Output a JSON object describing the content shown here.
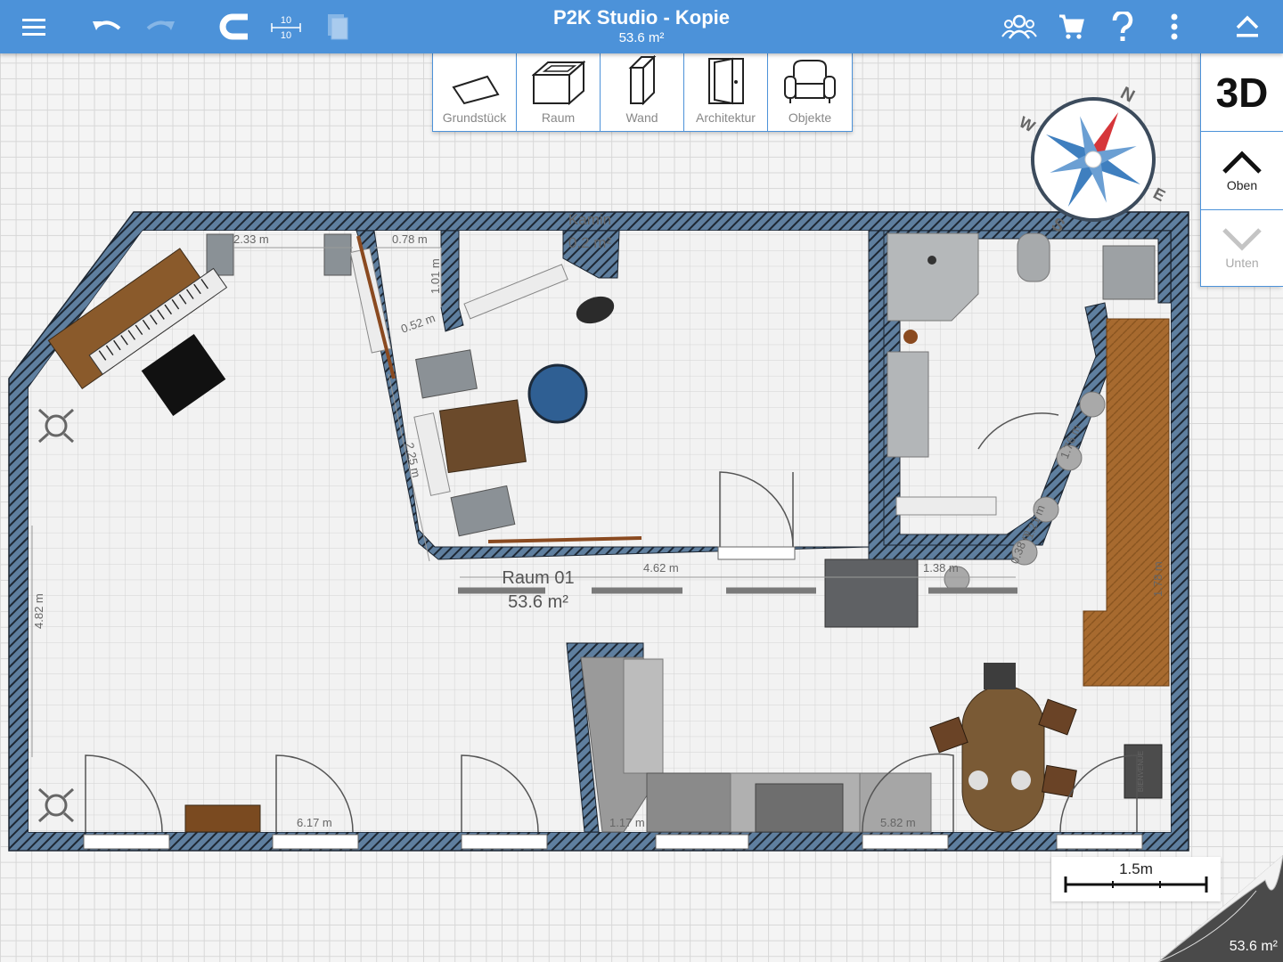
{
  "header": {
    "title": "P2K Studio - Kopie",
    "subtitle": "53.6 m²",
    "grid_label_top": "10",
    "grid_label_bottom": "10"
  },
  "palette": {
    "items": [
      {
        "label": "Grundstück",
        "icon": "plot-icon"
      },
      {
        "label": "Raum",
        "icon": "room-icon"
      },
      {
        "label": "Wand",
        "icon": "wall-icon"
      },
      {
        "label": "Architektur",
        "icon": "door-icon"
      },
      {
        "label": "Objekte",
        "icon": "armchair-icon"
      }
    ]
  },
  "right_panel": {
    "view_3d": "3D",
    "up_label": "Oben",
    "down_label": "Unten"
  },
  "compass": {
    "n": "N",
    "e": "E",
    "s": "S",
    "w": "W"
  },
  "plan": {
    "room_name": "Raum 01",
    "room_area": "53.6 m²",
    "fireplace_name": "Kamin",
    "fireplace_area": "0.2 m²",
    "dimensions": [
      {
        "id": "d1",
        "text": "2.33 m"
      },
      {
        "id": "d2",
        "text": "0.78 m"
      },
      {
        "id": "d3",
        "text": "1.01 m"
      },
      {
        "id": "d4",
        "text": "0.52 m"
      },
      {
        "id": "d5",
        "text": "2.25 m"
      },
      {
        "id": "d6",
        "text": "4.62 m"
      },
      {
        "id": "d7",
        "text": "1.38 m"
      },
      {
        "id": "d8",
        "text": "4.82 m"
      },
      {
        "id": "d9",
        "text": "6.17 m"
      },
      {
        "id": "d10",
        "text": "1.76 m"
      },
      {
        "id": "d11",
        "text": "1.21 m"
      },
      {
        "id": "d12",
        "text": "0.38 m"
      },
      {
        "id": "d13",
        "text": "5.82 m"
      },
      {
        "id": "d14",
        "text": "1.17 m"
      },
      {
        "id": "d15",
        "text": "1.78 m"
      }
    ],
    "sign_text": "BIENVENUE"
  },
  "scale": {
    "label": "1.5m"
  },
  "footer": {
    "total_area": "53.6 m²"
  },
  "colors": {
    "header_bg": "#4c92d9",
    "wall_fill": "#5f7f9f",
    "floor": "#f0f0f0"
  }
}
